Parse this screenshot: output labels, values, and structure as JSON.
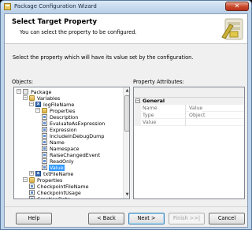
{
  "window": {
    "title": "Package Configuration Wizard",
    "close_glyph": "✕"
  },
  "header": {
    "title": "Select Target Property",
    "subtitle": "You can select the property to be configured."
  },
  "instruction": "Select the property which will have its value set by the configuration.",
  "objects_label": "Objects:",
  "attributes_label": "Property Attributes:",
  "tree": [
    {
      "label": "Package",
      "icon": "package-icon",
      "expander": "−"
    },
    {
      "label": "Variables",
      "icon": "folder-icon",
      "expander": "−"
    },
    {
      "label": "logFileName",
      "icon": "variable-icon",
      "expander": "−"
    },
    {
      "label": "Properties",
      "icon": "folder-icon",
      "expander": "−"
    },
    {
      "label": "Description",
      "icon": "property-icon"
    },
    {
      "label": "EvaluateAsExpression",
      "icon": "property-icon"
    },
    {
      "label": "Expression",
      "icon": "property-icon"
    },
    {
      "label": "IncludeInDebugDump",
      "icon": "property-icon"
    },
    {
      "label": "Name",
      "icon": "property-icon"
    },
    {
      "label": "Namespace",
      "icon": "property-icon"
    },
    {
      "label": "RaiseChangedEvent",
      "icon": "property-icon"
    },
    {
      "label": "ReadOnly",
      "icon": "property-icon"
    },
    {
      "label": "Value",
      "icon": "property-icon",
      "selected": true
    },
    {
      "label": "txtFileName",
      "icon": "variable-icon",
      "expander": "+"
    },
    {
      "label": "Properties",
      "icon": "folder-icon",
      "expander": "−"
    },
    {
      "label": "CheckpointFileName",
      "icon": "property-icon"
    },
    {
      "label": "CheckpointUsage",
      "icon": "property-icon"
    },
    {
      "label": "CreationDate",
      "icon": "property-icon"
    }
  ],
  "attributes": {
    "group": "General",
    "rows": [
      {
        "key": "Name",
        "value": "Value"
      },
      {
        "key": "Type",
        "value": "Object"
      },
      {
        "key": "Value",
        "value": ""
      }
    ]
  },
  "buttons": {
    "help": "Help",
    "back": "< Back",
    "next": "Next >",
    "finish": "Finish >>|",
    "cancel": "Cancel"
  }
}
